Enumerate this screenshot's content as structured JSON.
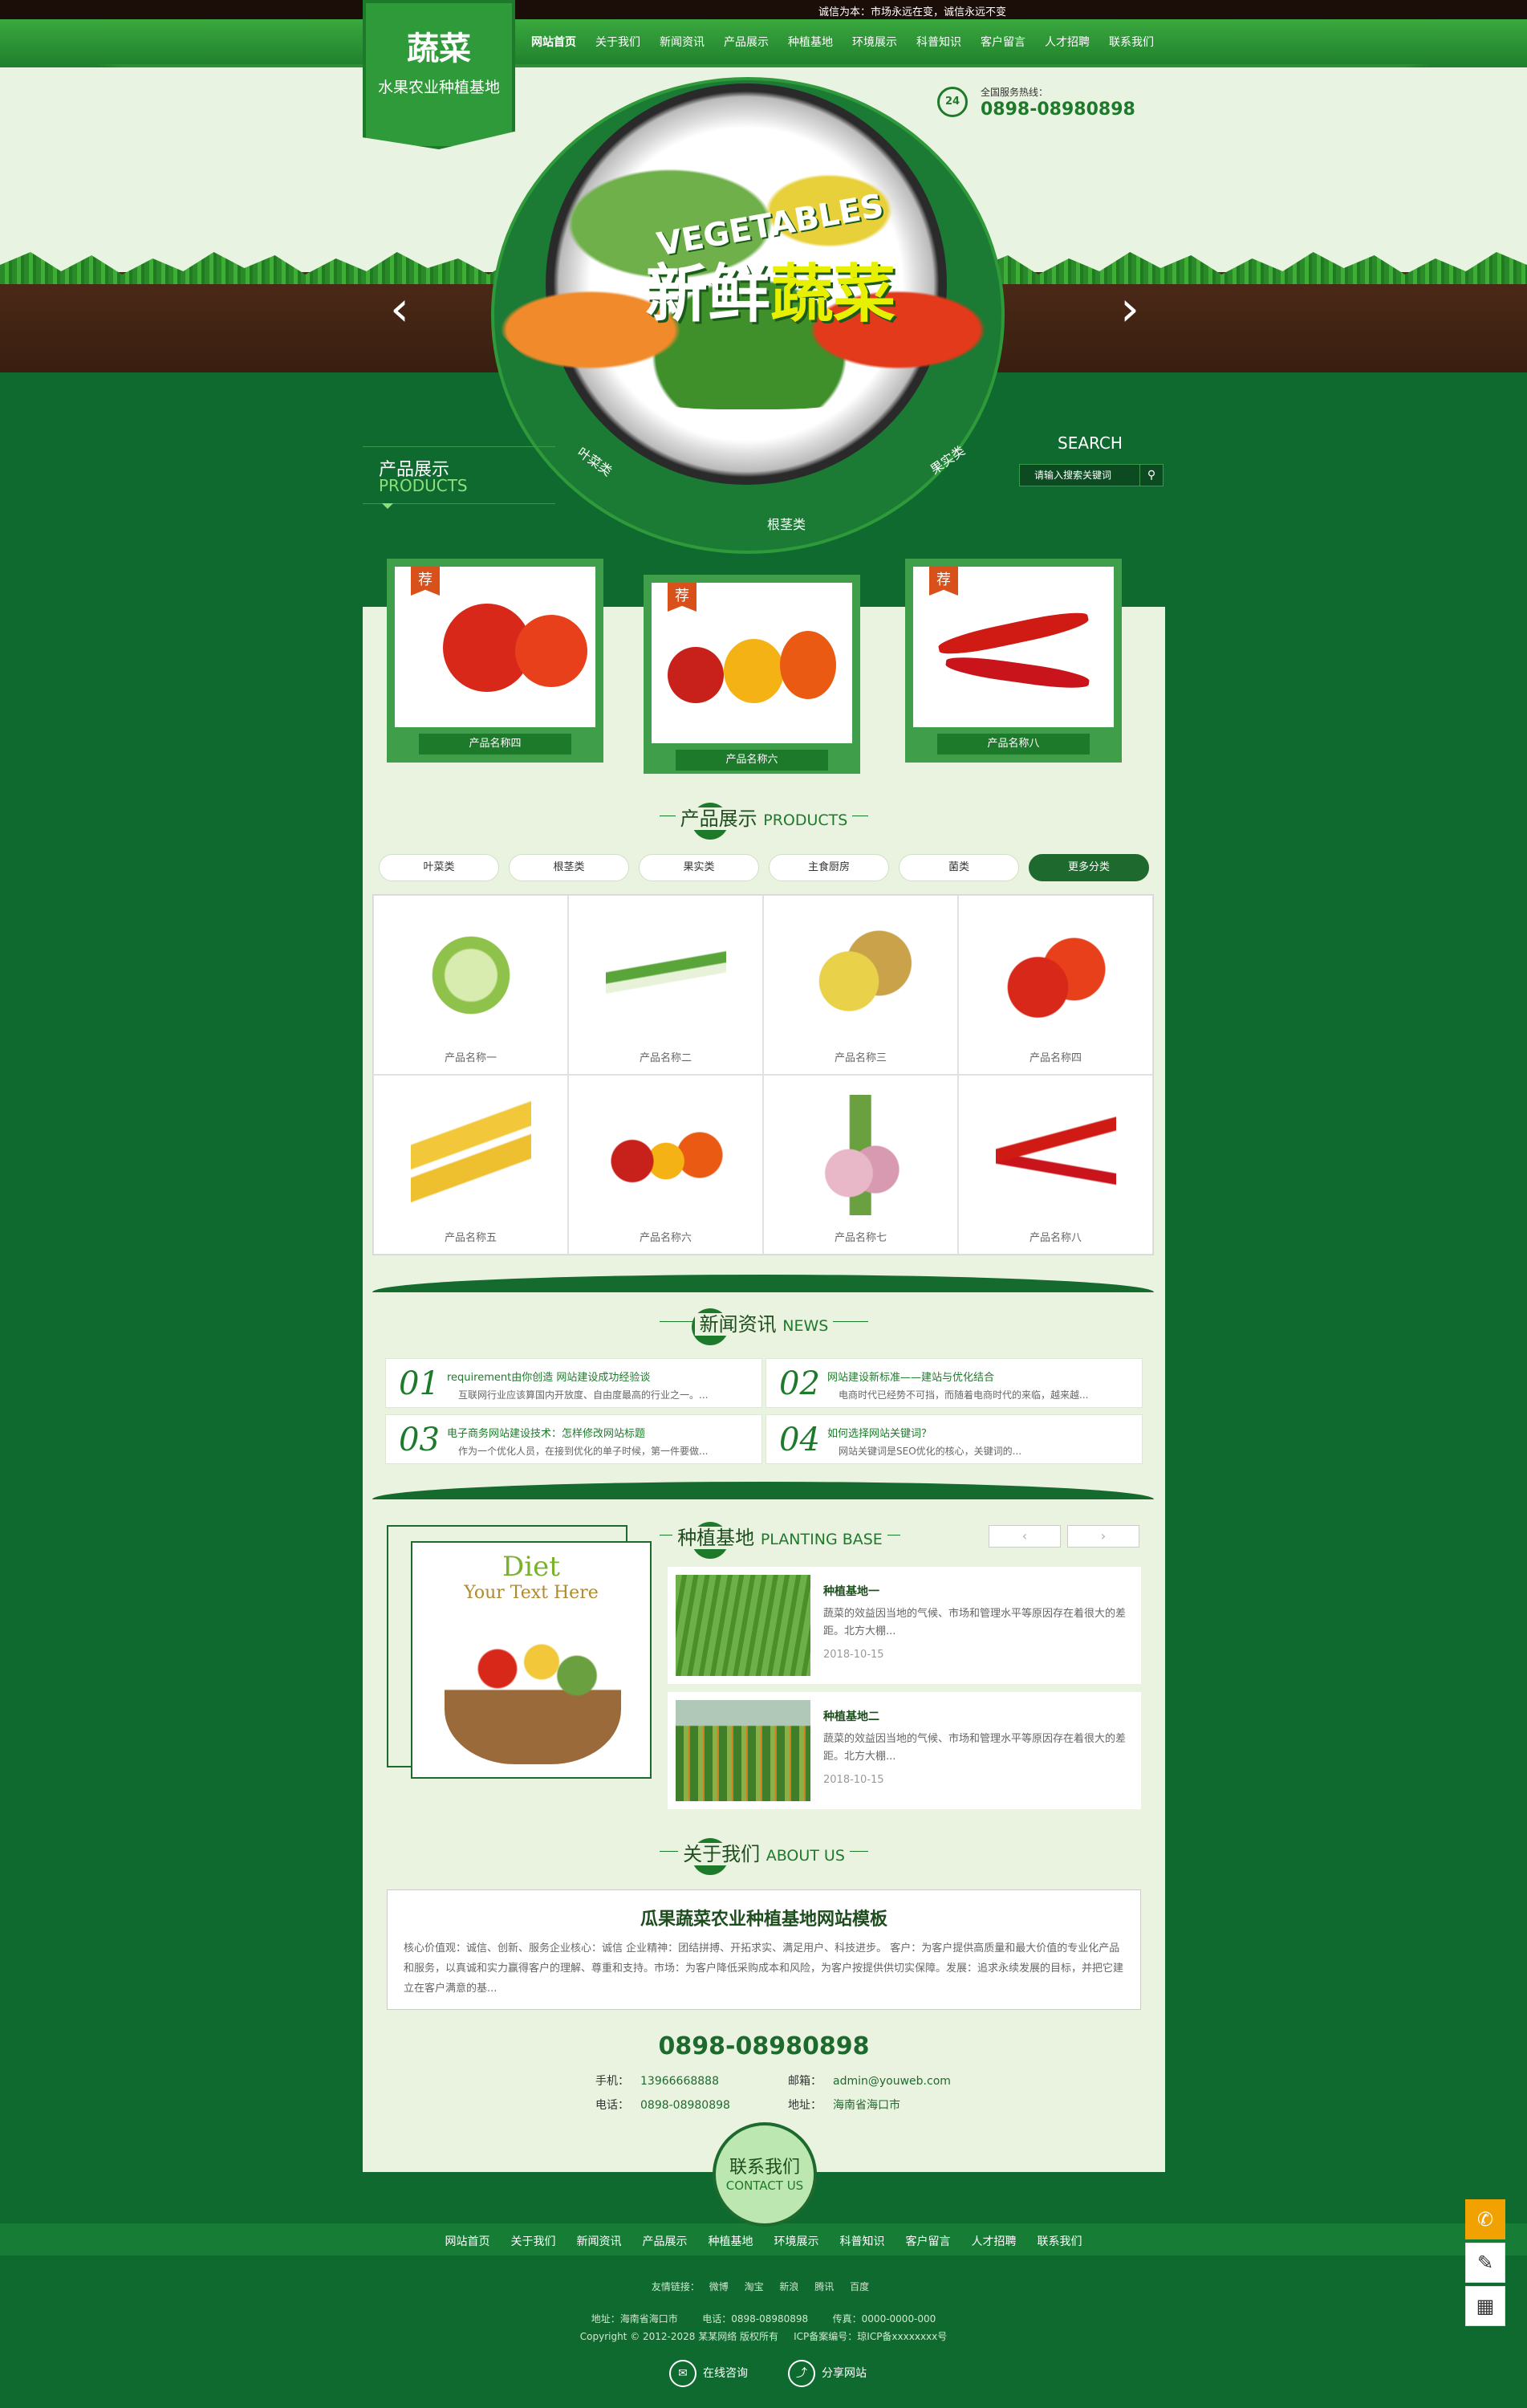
{
  "topbar": {
    "slogan": "诚信为本：市场永远在变，诚信永远不变"
  },
  "logo": {
    "line1": "蔬菜",
    "line2": "水果农业种植基地"
  },
  "nav": [
    "网站首页",
    "关于我们",
    "新闻资讯",
    "产品展示",
    "种植基地",
    "环境展示",
    "科普知识",
    "客户留言",
    "人才招聘",
    "联系我们"
  ],
  "hotline": {
    "label": "全国服务热线：",
    "number": "0898-08980898",
    "icon": "24"
  },
  "banner": {
    "en": "VEGETABLES",
    "cn_a": "新鲜",
    "cn_b": "蔬菜",
    "prev": "‹",
    "next": "›"
  },
  "wheel": [
    "叶菜类",
    "根茎类",
    "果实类"
  ],
  "search": {
    "label": "SEARCH",
    "placeholder": "请输入搜索关键词"
  },
  "products_head": {
    "cn": "产品展示",
    "en": "PRODUCTS"
  },
  "featured": [
    {
      "tag": "荐",
      "name": "产品名称四"
    },
    {
      "tag": "荐",
      "name": "产品名称六"
    },
    {
      "tag": "荐",
      "name": "产品名称八"
    }
  ],
  "products_sec": {
    "cn": "产品展示",
    "en": "PRODUCTS"
  },
  "tabs": [
    "叶菜类",
    "根茎类",
    "果实类",
    "主食厨房",
    "菌类",
    "更多分类"
  ],
  "products": [
    "产品名称一",
    "产品名称二",
    "产品名称三",
    "产品名称四",
    "产品名称五",
    "产品名称六",
    "产品名称七",
    "产品名称八"
  ],
  "news_sec": {
    "cn": "新闻资讯",
    "en": "NEWS"
  },
  "news": [
    {
      "num": "01",
      "title": "requirement由你创造 网站建设成功经验谈",
      "desc": "互联网行业应该算国内开放度、自由度最高的行业之一。..."
    },
    {
      "num": "02",
      "title": "网站建设新标准——建站与优化结合",
      "desc": "电商时代已经势不可挡，而随着电商时代的来临，越来越..."
    },
    {
      "num": "03",
      "title": "电子商务网站建设技术：怎样修改网站标题",
      "desc": "作为一个优化人员，在接到优化的单子时候，第一件要做..."
    },
    {
      "num": "04",
      "title": "如何选择网站关键词？",
      "desc": "网站关键词是SEO优化的核心，关键词的..."
    }
  ],
  "diet": {
    "a": "Diet",
    "b": "Your Text Here"
  },
  "base_sec": {
    "cn": "种植基地",
    "en": "PLANTING BASE"
  },
  "base_nav": {
    "prev": "‹",
    "next": "›"
  },
  "bases": [
    {
      "title": "种植基地一",
      "desc": "蔬菜的效益因当地的气候、市场和管理水平等原因存在着很大的差距。北方大棚...",
      "date": "2018-10-15"
    },
    {
      "title": "种植基地二",
      "desc": "蔬菜的效益因当地的气候、市场和管理水平等原因存在着很大的差距。北方大棚...",
      "date": "2018-10-15"
    }
  ],
  "about_sec": {
    "cn": "关于我们",
    "en": "ABOUT US"
  },
  "about": {
    "title": "瓜果蔬菜农业种植基地网站模板",
    "desc": "核心价值观：诚信、创新、服务企业核心：诚信 企业精神：团结拼搏、开拓求实、满足用户、科技进步。 客户：为客户提供高质量和最大价值的专业化产品和服务，以真诚和实力赢得客户的理解、尊重和支持。市场：为客户降低采购成本和风险，为客户按提供供切实保障。发展：追求永续发展的目标，并把它建立在客户满意的基..."
  },
  "contact": {
    "phone_big": "0898-08980898",
    "mobile_l": "手机：",
    "mobile": "13966668888",
    "tel_l": "电话：",
    "tel": "0898-08980898",
    "email_l": "邮箱：",
    "email": "admin@youweb.com",
    "addr_l": "地址：",
    "addr": "海南省海口市"
  },
  "contact_btn": {
    "cn": "联系我们",
    "en": "CONTACT US"
  },
  "footer": {
    "nav": [
      "网站首页",
      "关于我们",
      "新闻资讯",
      "产品展示",
      "种植基地",
      "环境展示",
      "科普知识",
      "客户留言",
      "人才招聘",
      "联系我们"
    ],
    "links_label": "友情链接：",
    "links": [
      "微博",
      "淘宝",
      "新浪",
      "腾讯",
      "百度"
    ],
    "info": "地址：海南省海口市        电话：0898-08980898        传真：0000-0000-000",
    "copy": "Copyright © 2012-2028 某某网络 版权所有     ICP备案编号：琼ICP备xxxxxxxx号",
    "online": "在线咨询",
    "share": "分享网站"
  },
  "colors": {
    "brand": "#1e6a2e",
    "bg": "#0e6a2f",
    "panel": "#eaf3e0",
    "accent": "#f2a200"
  }
}
